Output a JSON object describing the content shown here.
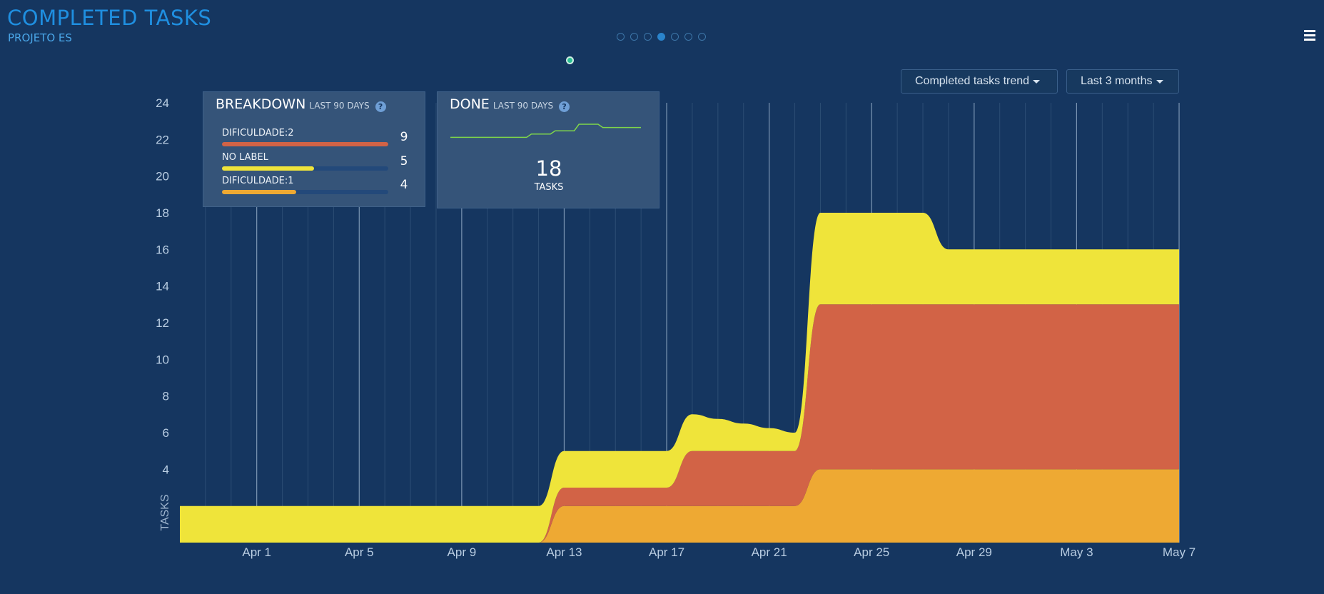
{
  "header": {
    "title": "COMPLETED TASKS",
    "subtitle": "PROJETO ES",
    "pager_count": 7,
    "pager_active_index": 3
  },
  "toolbar": {
    "metric_select": "Completed tasks trend",
    "range_select": "Last 3 months"
  },
  "breakdown": {
    "title": "BREAKDOWN",
    "period": "LAST 90 DAYS",
    "help": "?",
    "items": [
      {
        "label": "DIFICULDADE:2",
        "count": "9",
        "value": 9,
        "color": "#d26346"
      },
      {
        "label": "NO LABEL",
        "count": "5",
        "value": 5,
        "color": "#efe43a"
      },
      {
        "label": "DIFICULDADE:1",
        "count": "4",
        "value": 4,
        "color": "#eea933"
      }
    ],
    "max": 9
  },
  "done": {
    "title": "DONE",
    "period": "LAST 90 DAYS",
    "help": "?",
    "total": "18",
    "unit": "TASKS",
    "sparkline_color": "#7fd64a",
    "sparkline": [
      1,
      1,
      1,
      1,
      1,
      1,
      1,
      1,
      1,
      1,
      1,
      1,
      1,
      1,
      1,
      1,
      1,
      2,
      2,
      2,
      2,
      2,
      3,
      3,
      3,
      3,
      3,
      5,
      5,
      5,
      5,
      5,
      4,
      4,
      4,
      4,
      4,
      4,
      4,
      4,
      4
    ]
  },
  "chart_data": {
    "type": "area",
    "stacked": true,
    "ylabel": "TASKS",
    "ylim": [
      0,
      24
    ],
    "yticks": [
      4,
      6,
      8,
      10,
      12,
      14,
      16,
      18,
      20,
      22,
      24
    ],
    "xlim": [
      "Mar 29",
      "May 7"
    ],
    "xticks": [
      "Apr 1",
      "Apr 5",
      "Apr 9",
      "Apr 13",
      "Apr 17",
      "Apr 21",
      "Apr 25",
      "Apr 29",
      "May 3",
      "May 7"
    ],
    "grid": true,
    "series": [
      {
        "name": "DIFICULDADE:1",
        "color": "#eea933",
        "points": [
          [
            "Mar 29",
            0
          ],
          [
            "Apr 12",
            0
          ],
          [
            "Apr 13",
            2
          ],
          [
            "Apr 22",
            2
          ],
          [
            "Apr 23",
            4
          ],
          [
            "May 7",
            4
          ]
        ]
      },
      {
        "name": "DIFICULDADE:2",
        "color": "#d26346",
        "points": [
          [
            "Mar 29",
            0
          ],
          [
            "Apr 12",
            0
          ],
          [
            "Apr 13",
            1
          ],
          [
            "Apr 17",
            1
          ],
          [
            "Apr 18",
            3
          ],
          [
            "Apr 22",
            3
          ],
          [
            "Apr 23",
            9
          ],
          [
            "May 7",
            9
          ]
        ]
      },
      {
        "name": "NO LABEL",
        "color": "#efe43a",
        "points": [
          [
            "Mar 29",
            2
          ],
          [
            "Apr 12",
            2
          ],
          [
            "Apr 13",
            2
          ],
          [
            "Apr 17",
            2
          ],
          [
            "Apr 18",
            2
          ],
          [
            "Apr 22",
            1
          ],
          [
            "Apr 23",
            5
          ],
          [
            "Apr 27",
            5
          ],
          [
            "Apr 28",
            3
          ],
          [
            "May 7",
            3
          ]
        ]
      }
    ]
  }
}
